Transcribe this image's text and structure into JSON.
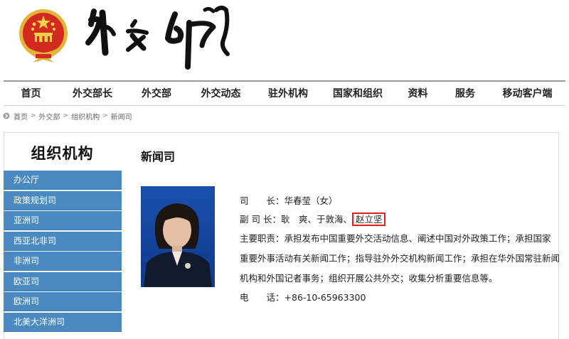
{
  "nav": [
    "首页",
    "外交部长",
    "外交部",
    "外交动态",
    "驻外机构",
    "国家和组织",
    "资料",
    "服务",
    "移动客户端"
  ],
  "breadcrumb": {
    "items": [
      "首页",
      "外交部",
      "组织机构",
      "新闻司"
    ],
    "separator": ">"
  },
  "sidebar": {
    "title": "组织机构",
    "items": [
      "办公厅",
      "政策规划司",
      "亚洲司",
      "西亚北非司",
      "非洲司",
      "欧亚司",
      "欧洲司",
      "北美大洋洲司"
    ]
  },
  "content": {
    "title": "新闻司",
    "director_label": "司　　长：",
    "director_value": "华春莹（女）",
    "deputy_label": "副 司 长：",
    "deputy_value": "耿　爽、于敦海、",
    "deputy_highlight": "赵立坚",
    "duties_label": "主要职责：",
    "duties_text": "承担发布中国重要外交活动信息、阐述中国对外政策工作；承担国家重要外事活动有关新闻工作；指导驻外外交机构新闻工作；承担在华外国常驻新闻机构和外国记者事务；组织开展公共外交；收集分析重要信息等。",
    "phone_label": "电　　话：",
    "phone_value": "+86-10-65963300"
  },
  "colors": {
    "sidebar_bg": "#4a8ac0",
    "highlight_border": "#e02020",
    "emblem_red": "#d22a1e",
    "emblem_gold": "#e3b43a"
  },
  "icons": [
    "national-emblem-logo",
    "ministry-calligraphy-logo",
    "breadcrumb-icon",
    "official-photo"
  ]
}
